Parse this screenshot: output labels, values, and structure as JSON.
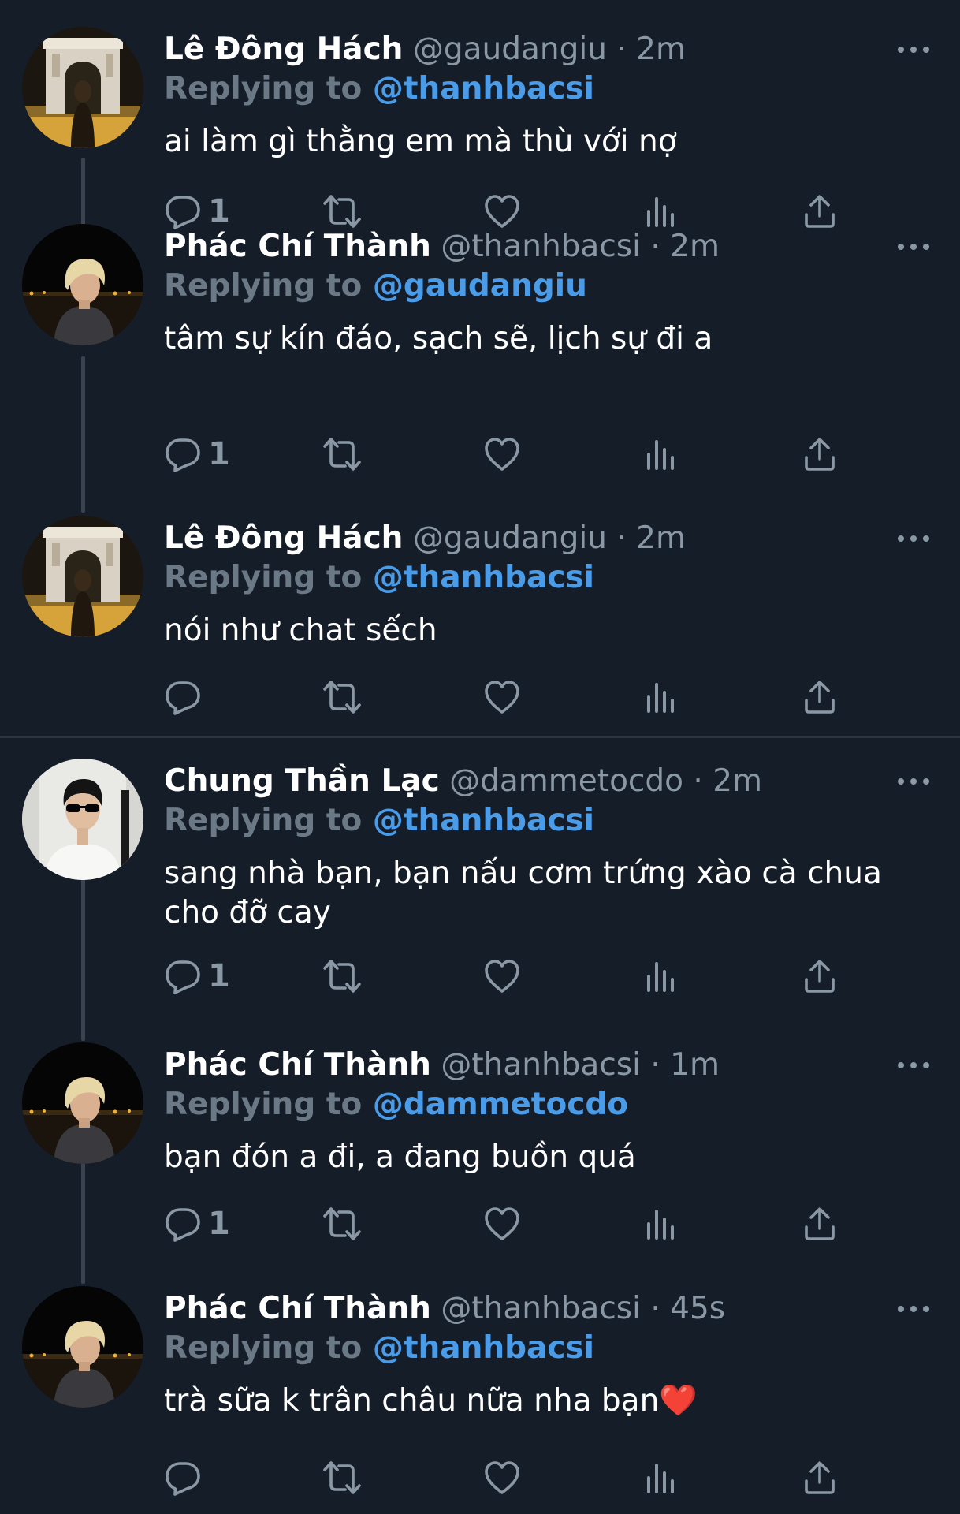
{
  "tweets": [
    {
      "name": "Lê Đông Hách",
      "handle": "@gaudangiu",
      "time": "2m",
      "replying_label": "Replying to",
      "replying_to": "@thanhbacsi",
      "text": "ai làm gì thằng em mà thù với nợ",
      "reply_count": "1",
      "avatar": "arch-avatar"
    },
    {
      "name": "Phác Chí Thành",
      "handle": "@thanhbacsi",
      "time": "2m",
      "replying_label": "Replying to",
      "replying_to": "@gaudangiu",
      "text": "tâm sự kín đáo, sạch sẽ, lịch sự đi a",
      "reply_count": "1",
      "avatar": "night-avatar"
    },
    {
      "name": "Lê Đông Hách",
      "handle": "@gaudangiu",
      "time": "2m",
      "replying_label": "Replying to",
      "replying_to": "@thanhbacsi",
      "text": "nói như chat sếch",
      "reply_count": "",
      "avatar": "arch-avatar"
    },
    {
      "name": "Chung Thần Lạc",
      "handle": "@dammetocdo",
      "time": "2m",
      "replying_label": "Replying to",
      "replying_to": "@thanhbacsi",
      "text": "sang nhà bạn, bạn nấu cơm trứng xào cà chua cho đỡ cay",
      "reply_count": "1",
      "avatar": "sunglasses-avatar"
    },
    {
      "name": "Phác Chí Thành",
      "handle": "@thanhbacsi",
      "time": "1m",
      "replying_label": "Replying to",
      "replying_to": "@dammetocdo",
      "text": "bạn đón a đi, a đang buồn quá",
      "reply_count": "1",
      "avatar": "night-avatar"
    },
    {
      "name": "Phác Chí Thành",
      "handle": "@thanhbacsi",
      "time": "45s",
      "replying_label": "Replying to",
      "replying_to": "@thanhbacsi",
      "text": "trà sữa k trân châu nữa nha bạn❤️",
      "reply_count": "",
      "avatar": "night-avatar"
    }
  ],
  "colors": {
    "background": "#151d28",
    "accent": "#4a9be8",
    "secondary_text": "#8a98a6",
    "icon": "#8a98a6"
  },
  "icons": {
    "reply": "reply-icon",
    "retweet": "retweet-icon",
    "like": "heart-icon",
    "analytics": "analytics-icon",
    "share": "share-icon",
    "more": "more-icon"
  }
}
